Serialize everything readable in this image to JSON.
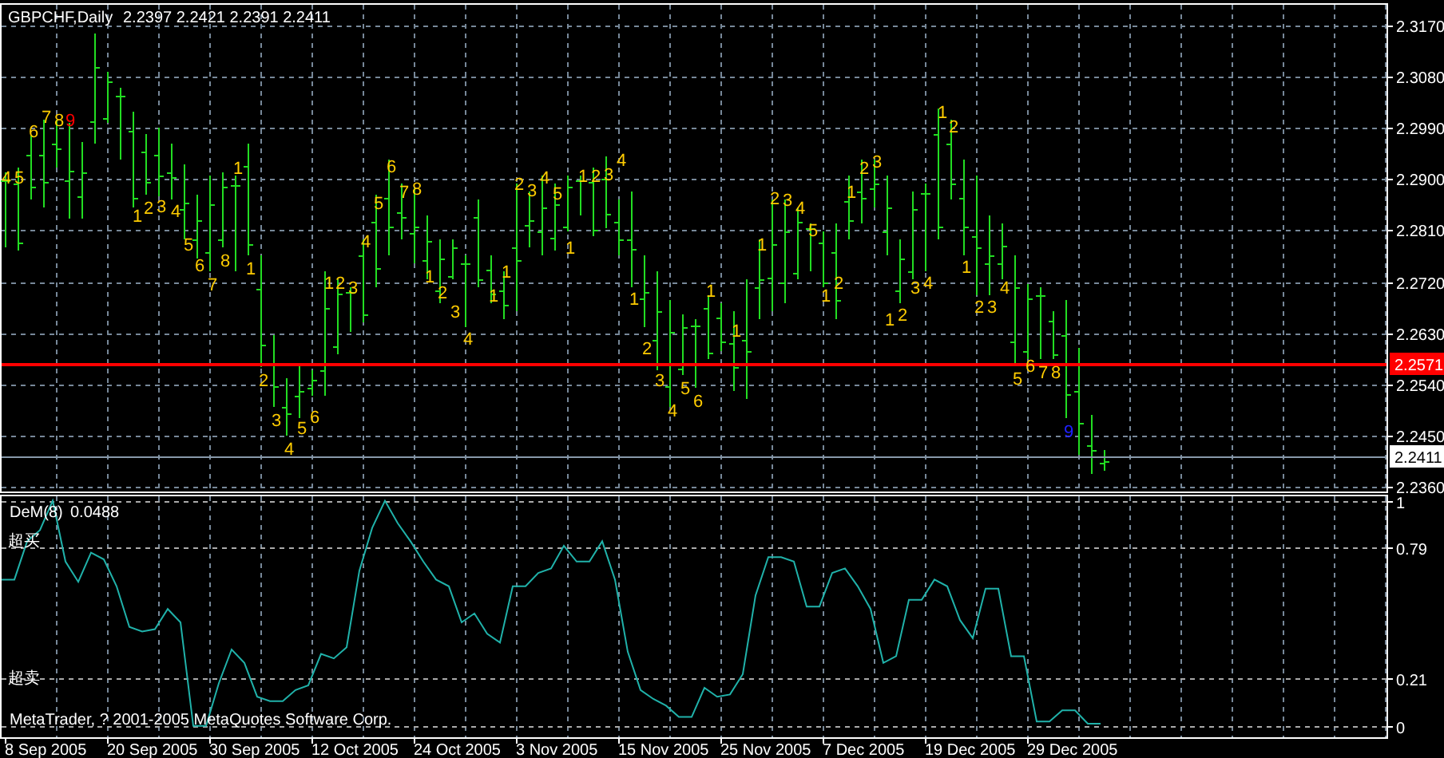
{
  "price_chart": {
    "symbol": "GBPCHF,Daily",
    "quote": "2.2397 2.2421 2.2391 2.2411",
    "price_axis": [
      "2.3170",
      "2.3080",
      "2.2990",
      "2.2900",
      "2.2810",
      "2.2720",
      "2.2630",
      "2.2540",
      "2.2450",
      "2.2360"
    ],
    "lines": [
      {
        "label": "2.2571",
        "kind": "level"
      },
      {
        "label": "2.2411",
        "kind": "bid"
      }
    ],
    "counts": [
      {
        "text": "4",
        "color": "#ffcc00"
      },
      {
        "text": "5",
        "color": "#ffcc00"
      },
      {
        "text": "6",
        "color": "#ffcc00"
      },
      {
        "text": "7",
        "color": "#ffcc00"
      },
      {
        "text": "8",
        "color": "#ffcc00"
      },
      {
        "text": "9",
        "color": "#ff0000"
      },
      {
        "text": "1",
        "color": "#ffcc00"
      },
      {
        "text": "2",
        "color": "#ffcc00"
      },
      {
        "text": "3",
        "color": "#ffcc00"
      },
      {
        "text": "4",
        "color": "#ffcc00"
      },
      {
        "text": "5",
        "color": "#ffcc00"
      },
      {
        "text": "6",
        "color": "#ffcc00"
      },
      {
        "text": "7",
        "color": "#ffcc00"
      },
      {
        "text": "8",
        "color": "#ffcc00"
      },
      {
        "text": "1",
        "color": "#ffcc00"
      },
      {
        "text": "1",
        "color": "#ffcc00"
      },
      {
        "text": "2",
        "color": "#ffcc00"
      },
      {
        "text": "3",
        "color": "#ffcc00"
      },
      {
        "text": "4",
        "color": "#ffcc00"
      },
      {
        "text": "5",
        "color": "#ffcc00"
      },
      {
        "text": "6",
        "color": "#ffcc00"
      },
      {
        "text": "1",
        "color": "#ffcc00"
      },
      {
        "text": "2",
        "color": "#ffcc00"
      },
      {
        "text": "3",
        "color": "#ffcc00"
      },
      {
        "text": "4",
        "color": "#ffcc00"
      },
      {
        "text": "5",
        "color": "#ffcc00"
      },
      {
        "text": "6",
        "color": "#ffcc00"
      },
      {
        "text": "7",
        "color": "#ffcc00"
      },
      {
        "text": "8",
        "color": "#ffcc00"
      },
      {
        "text": "1",
        "color": "#ffcc00"
      },
      {
        "text": "2",
        "color": "#ffcc00"
      },
      {
        "text": "3",
        "color": "#ffcc00"
      },
      {
        "text": "4",
        "color": "#ffcc00"
      },
      {
        "text": "1",
        "color": "#ffcc00"
      },
      {
        "text": "1",
        "color": "#ffcc00"
      },
      {
        "text": "2",
        "color": "#ffcc00"
      },
      {
        "text": "3",
        "color": "#ffcc00"
      },
      {
        "text": "4",
        "color": "#ffcc00"
      },
      {
        "text": "5",
        "color": "#ffcc00"
      },
      {
        "text": "1",
        "color": "#ffcc00"
      },
      {
        "text": "1",
        "color": "#ffcc00"
      },
      {
        "text": "2",
        "color": "#ffcc00"
      },
      {
        "text": "3",
        "color": "#ffcc00"
      },
      {
        "text": "4",
        "color": "#ffcc00"
      },
      {
        "text": "1",
        "color": "#ffcc00"
      },
      {
        "text": "2",
        "color": "#ffcc00"
      },
      {
        "text": "3",
        "color": "#ffcc00"
      },
      {
        "text": "4",
        "color": "#ffcc00"
      },
      {
        "text": "5",
        "color": "#ffcc00"
      },
      {
        "text": "6",
        "color": "#ffcc00"
      },
      {
        "text": "1",
        "color": "#ffcc00"
      },
      {
        "text": "1",
        "color": "#ffcc00"
      },
      {
        "text": "1",
        "color": "#ffcc00"
      },
      {
        "text": "2",
        "color": "#ffcc00"
      },
      {
        "text": "3",
        "color": "#ffcc00"
      },
      {
        "text": "4",
        "color": "#ffcc00"
      },
      {
        "text": "5",
        "color": "#ffcc00"
      },
      {
        "text": "1",
        "color": "#ffcc00"
      },
      {
        "text": "2",
        "color": "#ffcc00"
      },
      {
        "text": "1",
        "color": "#ffcc00"
      },
      {
        "text": "2",
        "color": "#ffcc00"
      },
      {
        "text": "3",
        "color": "#ffcc00"
      },
      {
        "text": "1",
        "color": "#ffcc00"
      },
      {
        "text": "2",
        "color": "#ffcc00"
      },
      {
        "text": "3",
        "color": "#ffcc00"
      },
      {
        "text": "4",
        "color": "#ffcc00"
      },
      {
        "text": "1",
        "color": "#ffcc00"
      },
      {
        "text": "2",
        "color": "#ffcc00"
      },
      {
        "text": "1",
        "color": "#ffcc00"
      },
      {
        "text": "2",
        "color": "#ffcc00"
      },
      {
        "text": "3",
        "color": "#ffcc00"
      },
      {
        "text": "4",
        "color": "#ffcc00"
      },
      {
        "text": "5",
        "color": "#ffcc00"
      },
      {
        "text": "6",
        "color": "#ffcc00"
      },
      {
        "text": "7",
        "color": "#ffcc00"
      },
      {
        "text": "8",
        "color": "#ffcc00"
      },
      {
        "text": "9",
        "color": "#2020ff"
      }
    ]
  },
  "indicator": {
    "current_value": "0.0488",
    "overbought_label": "超买",
    "oversold_label": "超卖",
    "copyright": "MetaTrader, ? 2001-2005 MetaQuotes Software Corp.",
    "chart_data": {
      "type": "line",
      "grid": true,
      "ylim": [
        -0.05,
        1.02
      ],
      "yticks": [
        1,
        0.79,
        0.21,
        0
      ],
      "series": [
        {
          "name": "DeM(8)",
          "color": "#20b2aa",
          "values": [
            0.65,
            0.65,
            0.82,
            0.87,
            1.0,
            0.73,
            0.64,
            0.77,
            0.74,
            0.62,
            0.44,
            0.42,
            0.43,
            0.52,
            0.46,
            0,
            0,
            0.19,
            0.34,
            0.28,
            0.13,
            0.11,
            0.11,
            0.16,
            0.18,
            0.32,
            0.3,
            0.35,
            0.69,
            0.88,
            1.0,
            0.9,
            0.82,
            0.73,
            0.65,
            0.62,
            0.46,
            0.5,
            0.41,
            0.37,
            0.62,
            0.62,
            0.68,
            0.7,
            0.8,
            0.73,
            0.73,
            0.82,
            0.65,
            0.33,
            0.16,
            0.12,
            0.09,
            0.04,
            0.04,
            0.17,
            0.13,
            0.14,
            0.23,
            0.58,
            0.75,
            0.75,
            0.73,
            0.53,
            0.53,
            0.68,
            0.7,
            0.62,
            0.52,
            0.28,
            0.31,
            0.56,
            0.56,
            0.65,
            0.62,
            0.47,
            0.39,
            0.61,
            0.61,
            0.31,
            0.31,
            0.02,
            0.02,
            0.07,
            0.07,
            0.01,
            0.01
          ]
        }
      ]
    }
  },
  "date_axis": [
    "8 Sep 2005",
    "20 Sep 2005",
    "30 Sep 2005",
    "12 Oct 2005",
    "24 Oct 2005",
    "3 Nov 2005",
    "15 Nov 2005",
    "25 Nov 2005",
    "7 Dec 2005",
    "19 Dec 2005",
    "29 Dec 2005"
  ]
}
